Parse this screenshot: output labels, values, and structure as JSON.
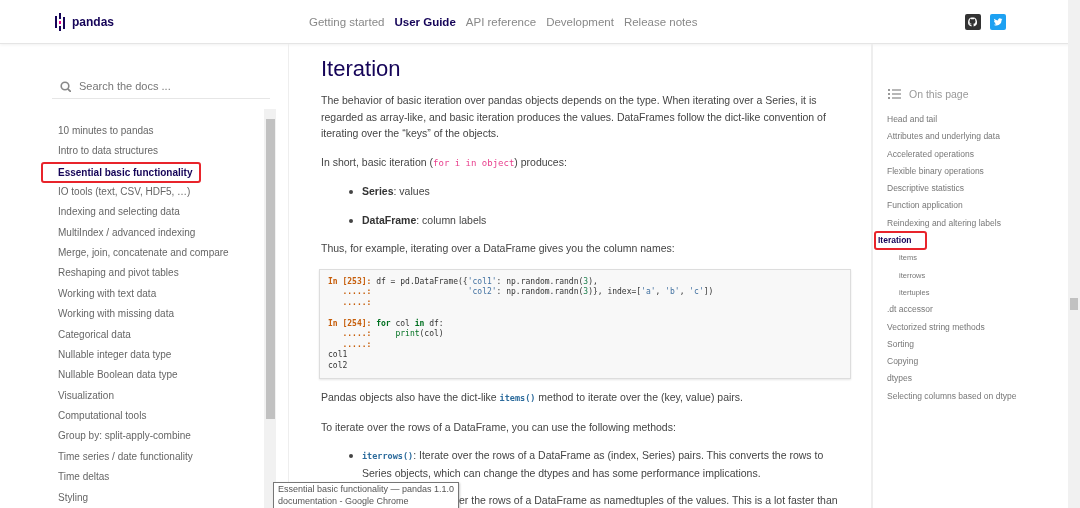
{
  "header": {
    "logo_text": "pandas",
    "nav": [
      {
        "label": "Getting started",
        "selected": false
      },
      {
        "label": "User Guide",
        "selected": true
      },
      {
        "label": "API reference",
        "selected": false
      },
      {
        "label": "Development",
        "selected": false
      },
      {
        "label": "Release notes",
        "selected": false
      }
    ]
  },
  "sidebar": {
    "search": {
      "placeholder": "Search the docs ..."
    },
    "items": [
      {
        "label": "10 minutes to pandas",
        "selected": false,
        "highlighted": false
      },
      {
        "label": "Intro to data structures",
        "selected": false,
        "highlighted": false
      },
      {
        "label": "Essential basic functionality",
        "selected": true,
        "highlighted": true
      },
      {
        "label": "IO tools (text, CSV, HDF5, …)",
        "selected": false,
        "highlighted": false
      },
      {
        "label": "Indexing and selecting data",
        "selected": false,
        "highlighted": false
      },
      {
        "label": "MultiIndex / advanced indexing",
        "selected": false,
        "highlighted": false
      },
      {
        "label": "Merge, join, concatenate and compare",
        "selected": false,
        "highlighted": false
      },
      {
        "label": "Reshaping and pivot tables",
        "selected": false,
        "highlighted": false
      },
      {
        "label": "Working with text data",
        "selected": false,
        "highlighted": false
      },
      {
        "label": "Working with missing data",
        "selected": false,
        "highlighted": false
      },
      {
        "label": "Categorical data",
        "selected": false,
        "highlighted": false
      },
      {
        "label": "Nullable integer data type",
        "selected": false,
        "highlighted": false
      },
      {
        "label": "Nullable Boolean data type",
        "selected": false,
        "highlighted": false
      },
      {
        "label": "Visualization",
        "selected": false,
        "highlighted": false
      },
      {
        "label": "Computational tools",
        "selected": false,
        "highlighted": false
      },
      {
        "label": "Group by: split-apply-combine",
        "selected": false,
        "highlighted": false
      },
      {
        "label": "Time series / date functionality",
        "selected": false,
        "highlighted": false
      },
      {
        "label": "Time deltas",
        "selected": false,
        "highlighted": false
      },
      {
        "label": "Styling",
        "selected": false,
        "highlighted": false
      }
    ]
  },
  "content": {
    "title": "Iteration",
    "blocks": [
      {
        "kind": "para",
        "parts": [
          {
            "kind": "text",
            "text": "The behavior of basic iteration over pandas objects depends on the type. When iterating over a Series, it is regarded as array-like, and basic iteration produces the values. DataFrames follow the dict-like convention of iterating over the “keys” of the objects."
          }
        ]
      },
      {
        "kind": "para",
        "parts": [
          {
            "kind": "text",
            "text": "In short, basic iteration ("
          },
          {
            "kind": "literal",
            "text": "for i in object"
          },
          {
            "kind": "text",
            "text": ") produces:"
          }
        ]
      },
      {
        "kind": "bullet",
        "parts": [
          {
            "kind": "strong",
            "text": "Series"
          },
          {
            "kind": "text",
            "text": ": values"
          }
        ]
      },
      {
        "kind": "bullet",
        "parts": [
          {
            "kind": "strong",
            "text": "DataFrame"
          },
          {
            "kind": "text",
            "text": ": column labels"
          }
        ]
      },
      {
        "kind": "para",
        "parts": [
          {
            "kind": "text",
            "text": "Thus, for example, iterating over a DataFrame gives you the column names:"
          }
        ]
      },
      {
        "kind": "code",
        "lines": [
          {
            "kind": "code",
            "tokens": [
              {
                "kind": "prompt",
                "text": "In [253]: "
              },
              {
                "kind": "plain",
                "text": "df = pd.DataFrame({"
              },
              {
                "kind": "string",
                "text": "'col1'"
              },
              {
                "kind": "plain",
                "text": ": np.random.randn("
              },
              {
                "kind": "number",
                "text": "3"
              },
              {
                "kind": "plain",
                "text": "),"
              }
            ]
          },
          {
            "kind": "code",
            "tokens": [
              {
                "kind": "prompt",
                "text": "   .....:                    "
              },
              {
                "kind": "string",
                "text": "'col2'"
              },
              {
                "kind": "plain",
                "text": ": np.random.randn("
              },
              {
                "kind": "number",
                "text": "3"
              },
              {
                "kind": "plain",
                "text": ")}, index=["
              },
              {
                "kind": "string",
                "text": "'a'"
              },
              {
                "kind": "plain",
                "text": ", "
              },
              {
                "kind": "string",
                "text": "'b'"
              },
              {
                "kind": "plain",
                "text": ", "
              },
              {
                "kind": "string",
                "text": "'c'"
              },
              {
                "kind": "plain",
                "text": "])"
              }
            ]
          },
          {
            "kind": "code",
            "tokens": [
              {
                "kind": "prompt",
                "text": "   .....: "
              }
            ]
          },
          {
            "kind": "blank"
          },
          {
            "kind": "code",
            "tokens": [
              {
                "kind": "prompt",
                "text": "In [254]: "
              },
              {
                "kind": "keyword",
                "text": "for"
              },
              {
                "kind": "plain",
                "text": " col "
              },
              {
                "kind": "keyword",
                "text": "in"
              },
              {
                "kind": "plain",
                "text": " df:"
              }
            ]
          },
          {
            "kind": "code",
            "tokens": [
              {
                "kind": "prompt",
                "text": "   .....:     "
              },
              {
                "kind": "builtin",
                "text": "print"
              },
              {
                "kind": "plain",
                "text": "(col)"
              }
            ]
          },
          {
            "kind": "code",
            "tokens": [
              {
                "kind": "prompt",
                "text": "   .....: "
              }
            ]
          },
          {
            "kind": "code",
            "tokens": [
              {
                "kind": "plain",
                "text": "col1"
              }
            ]
          },
          {
            "kind": "code",
            "tokens": [
              {
                "kind": "plain",
                "text": "col2"
              }
            ]
          }
        ]
      },
      {
        "kind": "para",
        "parts": [
          {
            "kind": "text",
            "text": "Pandas objects also have the dict-like "
          },
          {
            "kind": "method",
            "text": "items()"
          },
          {
            "kind": "text",
            "text": " method to iterate over the (key, value) pairs."
          }
        ]
      },
      {
        "kind": "para",
        "parts": [
          {
            "kind": "text",
            "text": "To iterate over the rows of a DataFrame, you can use the following methods:"
          }
        ]
      },
      {
        "kind": "bullet",
        "parts": [
          {
            "kind": "method",
            "text": "iterrows()"
          },
          {
            "kind": "text",
            "text": ": Iterate over the rows of a DataFrame as (index, Series) pairs. This converts the rows to Series objects, which can change the dtypes and has some performance implications."
          }
        ]
      },
      {
        "kind": "covered",
        "parts": [
          {
            "kind": "text",
            "text": "er the rows of a DataFrame as namedtuples of the values. This is a lot faster than"
          }
        ]
      }
    ]
  },
  "toc": {
    "heading": "On this page",
    "items": [
      {
        "label": "Head and tail",
        "selected": false,
        "highlighted": false
      },
      {
        "label": "Attributes and underlying data",
        "selected": false,
        "highlighted": false
      },
      {
        "label": "Accelerated operations",
        "selected": false,
        "highlighted": false
      },
      {
        "label": "Flexible binary operations",
        "selected": false,
        "highlighted": false
      },
      {
        "label": "Descriptive statistics",
        "selected": false,
        "highlighted": false
      },
      {
        "label": "Function application",
        "selected": false,
        "highlighted": false
      },
      {
        "label": "Reindexing and altering labels",
        "selected": false,
        "highlighted": false
      },
      {
        "label": "Iteration",
        "selected": true,
        "highlighted": true,
        "children": [
          {
            "label": "items",
            "selected": false,
            "highlighted": false
          },
          {
            "label": "iterrows",
            "selected": false,
            "highlighted": false
          },
          {
            "label": "itertuples",
            "selected": false,
            "highlighted": false
          }
        ]
      },
      {
        "label": ".dt accessor",
        "selected": false,
        "highlighted": false
      },
      {
        "label": "Vectorized string methods",
        "selected": false,
        "highlighted": false
      },
      {
        "label": "Sorting",
        "selected": false,
        "highlighted": false
      },
      {
        "label": "Copying",
        "selected": false,
        "highlighted": false
      },
      {
        "label": "dtypes",
        "selected": false,
        "highlighted": false
      },
      {
        "label": "Selecting columns based on dtype",
        "selected": false,
        "highlighted": false
      }
    ]
  },
  "tooltip": {
    "lines": [
      "Essential basic functionality — pandas 1.1.0",
      "documentation - Google Chrome"
    ]
  }
}
